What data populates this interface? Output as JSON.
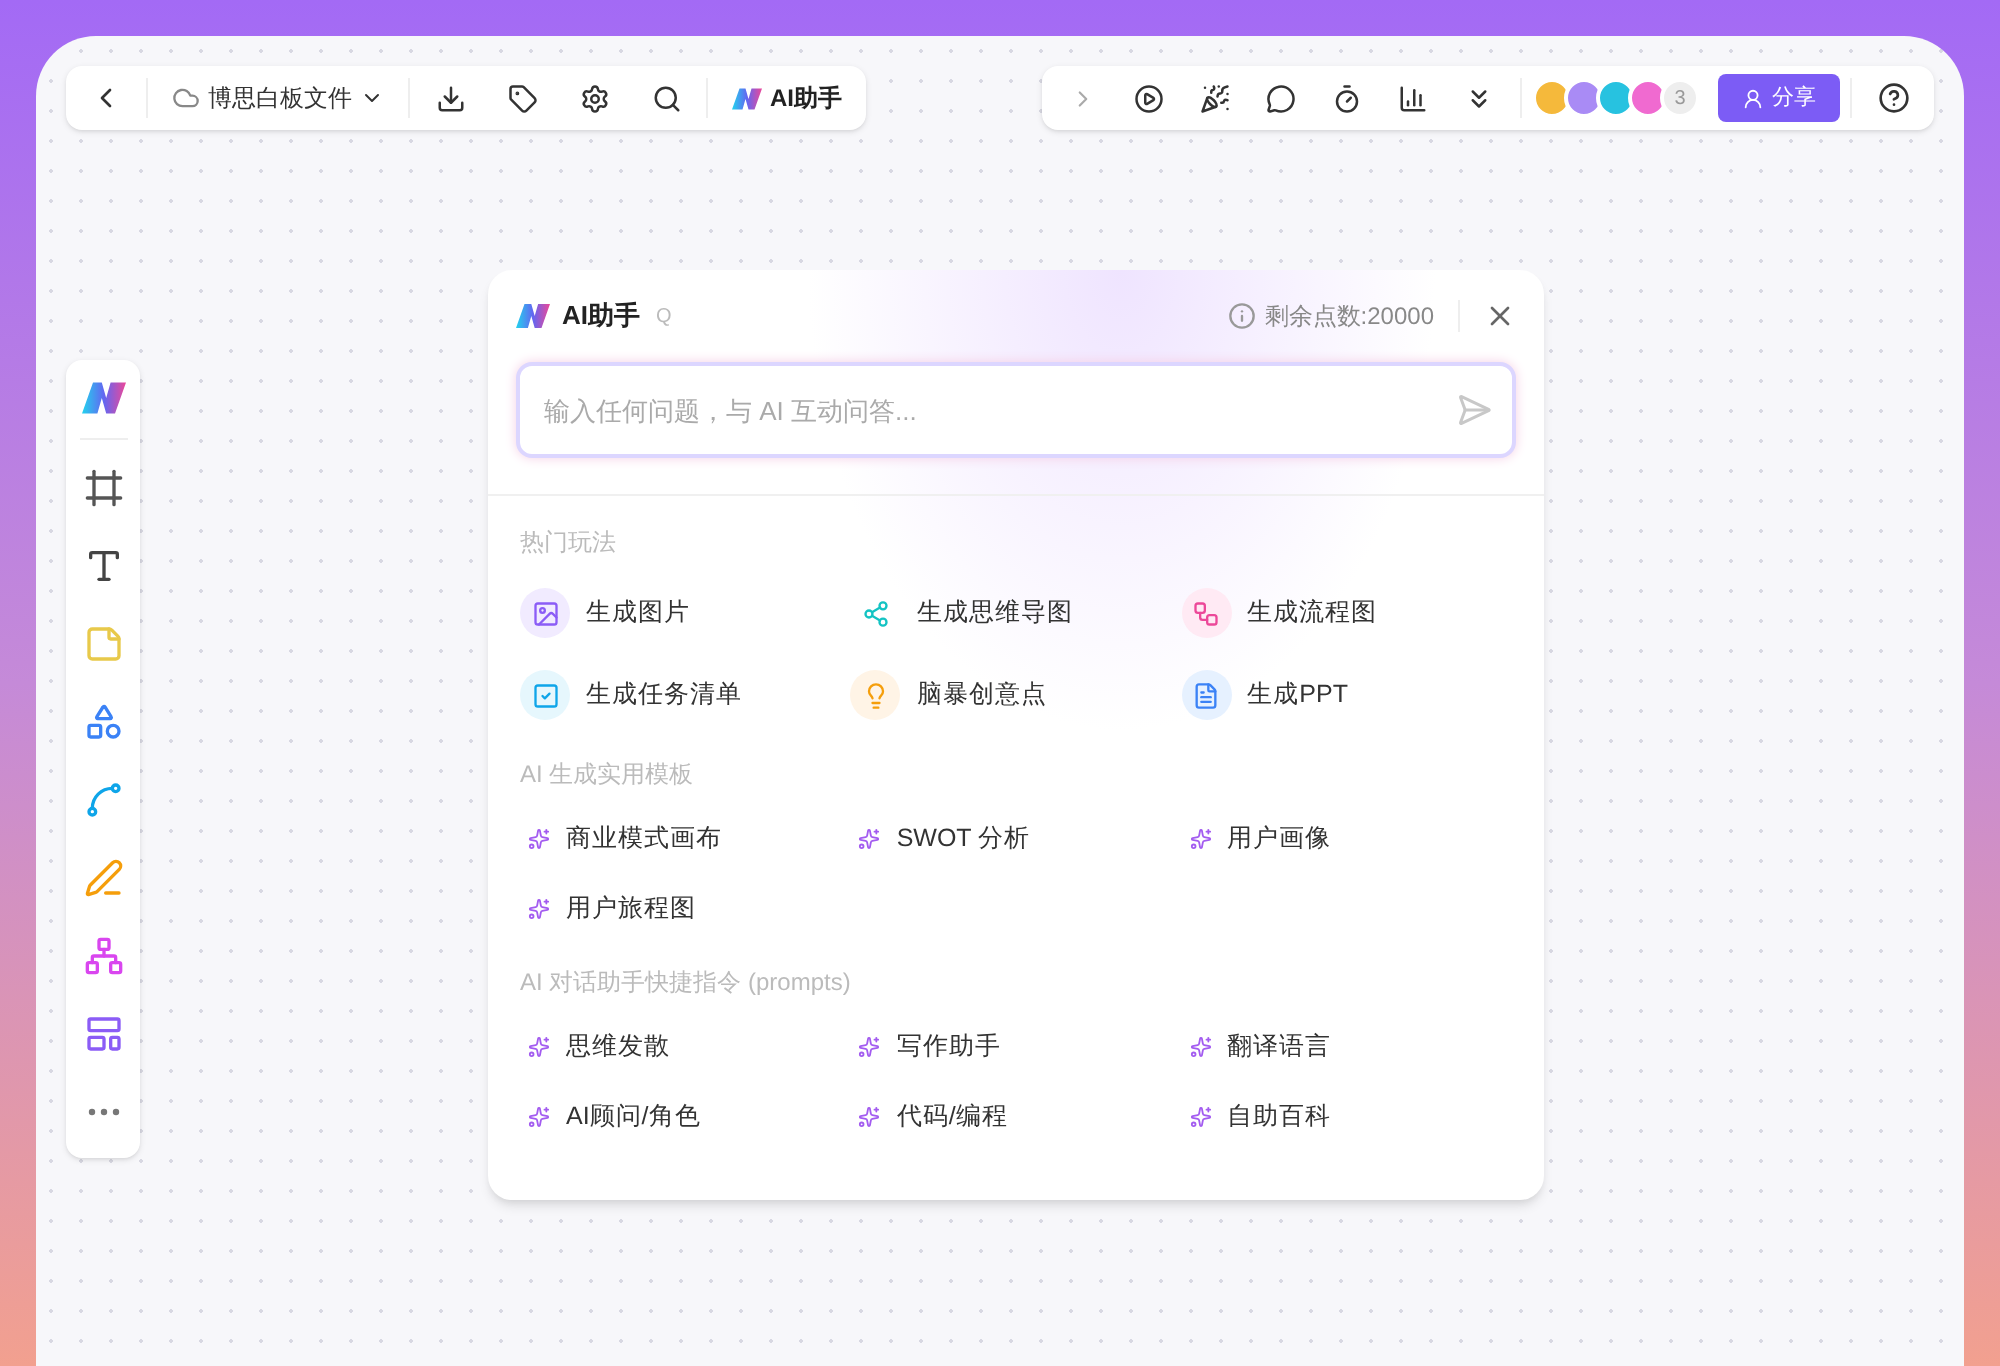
{
  "top_bar": {
    "file_name": "博思白板文件",
    "ai_button": "AI助手"
  },
  "right_bar": {
    "collaborator_count": "3",
    "share_button": "分享"
  },
  "avatars": [
    {
      "color": "#f5b93b"
    },
    {
      "color": "#a98bf5"
    },
    {
      "color": "#27c2e0"
    },
    {
      "color": "#f06ad0"
    }
  ],
  "dialog": {
    "title": "AI助手",
    "shortcut": "Q",
    "points": "剩余点数:20000",
    "input": {
      "placeholder": "输入任何问题，与 AI 互动问答..."
    },
    "sections": [
      {
        "title": "热门玩法",
        "kind": "feature",
        "items": [
          {
            "label": "生成图片",
            "kind": "image"
          },
          {
            "label": "生成思维导图",
            "kind": "mindmap"
          },
          {
            "label": "生成流程图",
            "kind": "flow"
          },
          {
            "label": "生成任务清单",
            "kind": "task"
          },
          {
            "label": "脑暴创意点",
            "kind": "idea"
          },
          {
            "label": "生成PPT",
            "kind": "ppt"
          }
        ]
      },
      {
        "title": "AI 生成实用模板",
        "kind": "prompt",
        "items": [
          {
            "label": "商业模式画布"
          },
          {
            "label": "SWOT 分析"
          },
          {
            "label": "用户画像"
          },
          {
            "label": "用户旅程图"
          }
        ]
      },
      {
        "title": "AI 对话助手快捷指令 (prompts)",
        "kind": "prompt",
        "items": [
          {
            "label": "思维发散"
          },
          {
            "label": "写作助手"
          },
          {
            "label": "翻译语言"
          },
          {
            "label": "AI顾问/角色"
          },
          {
            "label": "代码/编程"
          },
          {
            "label": "自助百科"
          }
        ]
      }
    ]
  }
}
